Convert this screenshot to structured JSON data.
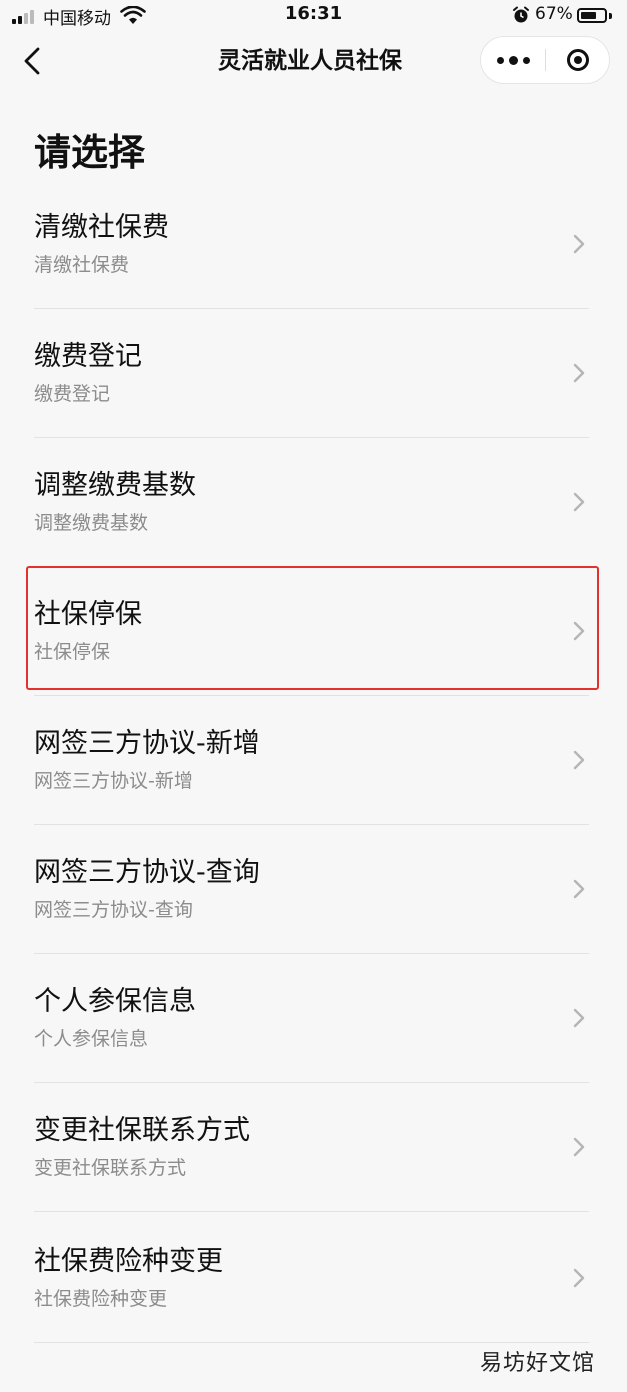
{
  "status_bar": {
    "carrier": "中国移动",
    "time": "16:31",
    "battery": "67%",
    "battery_level": 0.67
  },
  "nav": {
    "title": "灵活就业人员社保"
  },
  "heading": "请选择",
  "items": [
    {
      "title": "清缴社保费",
      "subtitle": "清缴社保费"
    },
    {
      "title": "缴费登记",
      "subtitle": "缴费登记"
    },
    {
      "title": "调整缴费基数",
      "subtitle": "调整缴费基数"
    },
    {
      "title": "社保停保",
      "subtitle": "社保停保",
      "highlighted": true
    },
    {
      "title": "网签三方协议-新增",
      "subtitle": "网签三方协议-新增"
    },
    {
      "title": "网签三方协议-查询",
      "subtitle": "网签三方协议-查询"
    },
    {
      "title": "个人参保信息",
      "subtitle": "个人参保信息"
    },
    {
      "title": "变更社保联系方式",
      "subtitle": "变更社保联系方式"
    },
    {
      "title": "社保费险种变更",
      "subtitle": "社保费险种变更"
    }
  ],
  "highlight_color": "#e5312d",
  "watermark": "易坊好文馆"
}
